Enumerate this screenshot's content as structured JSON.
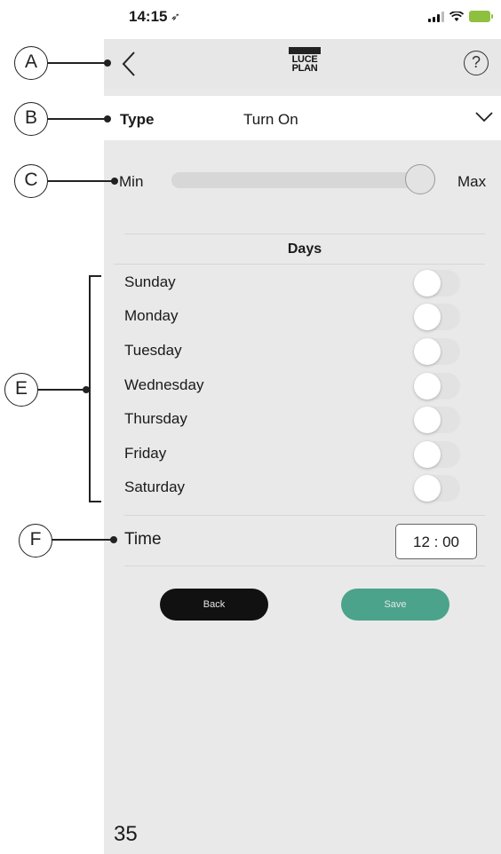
{
  "status_bar": {
    "time": "14:15"
  },
  "nav": {
    "logo_line1": "LUCE",
    "logo_line2": "PLAN",
    "help_symbol": "?"
  },
  "type_row": {
    "label": "Type",
    "value": "Turn On"
  },
  "intensity": {
    "min_label": "Min",
    "max_label": "Max",
    "level": 0.95
  },
  "days": {
    "header": "Days",
    "items": [
      {
        "label": "Sunday",
        "enabled": false
      },
      {
        "label": "Monday",
        "enabled": false
      },
      {
        "label": "Tuesday",
        "enabled": false
      },
      {
        "label": "Wednesday",
        "enabled": false
      },
      {
        "label": "Thursday",
        "enabled": false
      },
      {
        "label": "Friday",
        "enabled": false
      },
      {
        "label": "Saturday",
        "enabled": false
      }
    ]
  },
  "time_row": {
    "label": "Time",
    "value": "12 : 00"
  },
  "buttons": {
    "back": "Back",
    "save": "Save"
  },
  "colors": {
    "save": "#4aa38a",
    "back": "#111111",
    "battery": "#8fbf3e"
  },
  "annotations": {
    "a": "A",
    "b": "B",
    "c": "C",
    "e": "E",
    "f": "F"
  },
  "page_number": "35"
}
